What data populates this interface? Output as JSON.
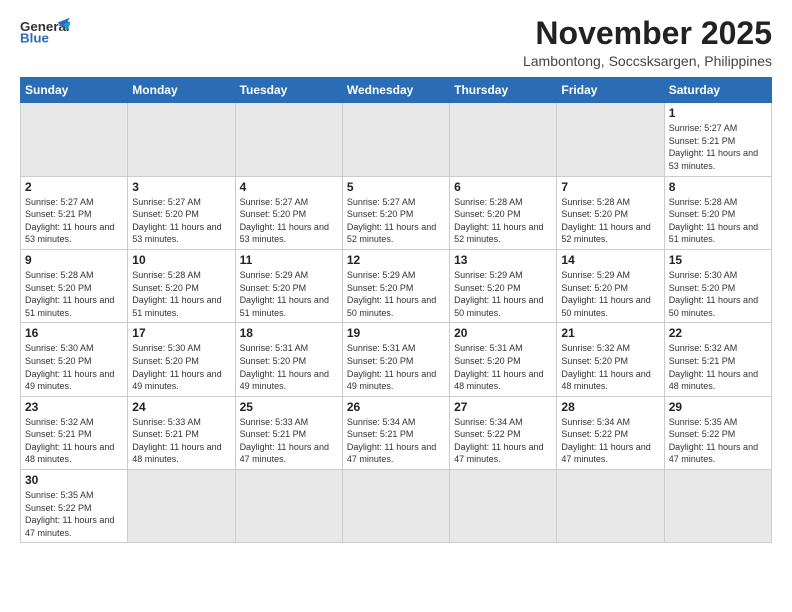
{
  "logo": {
    "text_general": "General",
    "text_blue": "Blue"
  },
  "header": {
    "month": "November 2025",
    "location": "Lambontong, Soccsksargen, Philippines"
  },
  "weekdays": [
    "Sunday",
    "Monday",
    "Tuesday",
    "Wednesday",
    "Thursday",
    "Friday",
    "Saturday"
  ],
  "rows": [
    [
      {
        "day": "",
        "empty": true
      },
      {
        "day": "",
        "empty": true
      },
      {
        "day": "",
        "empty": true
      },
      {
        "day": "",
        "empty": true
      },
      {
        "day": "",
        "empty": true
      },
      {
        "day": "",
        "empty": true
      },
      {
        "day": "1",
        "rise": "Sunrise: 5:27 AM",
        "set": "Sunset: 5:21 PM",
        "daylight": "Daylight: 11 hours and 53 minutes."
      }
    ],
    [
      {
        "day": "2",
        "rise": "Sunrise: 5:27 AM",
        "set": "Sunset: 5:21 PM",
        "daylight": "Daylight: 11 hours and 53 minutes."
      },
      {
        "day": "3",
        "rise": "Sunrise: 5:27 AM",
        "set": "Sunset: 5:20 PM",
        "daylight": "Daylight: 11 hours and 53 minutes."
      },
      {
        "day": "4",
        "rise": "Sunrise: 5:27 AM",
        "set": "Sunset: 5:20 PM",
        "daylight": "Daylight: 11 hours and 53 minutes."
      },
      {
        "day": "5",
        "rise": "Sunrise: 5:27 AM",
        "set": "Sunset: 5:20 PM",
        "daylight": "Daylight: 11 hours and 52 minutes."
      },
      {
        "day": "6",
        "rise": "Sunrise: 5:28 AM",
        "set": "Sunset: 5:20 PM",
        "daylight": "Daylight: 11 hours and 52 minutes."
      },
      {
        "day": "7",
        "rise": "Sunrise: 5:28 AM",
        "set": "Sunset: 5:20 PM",
        "daylight": "Daylight: 11 hours and 52 minutes."
      },
      {
        "day": "8",
        "rise": "Sunrise: 5:28 AM",
        "set": "Sunset: 5:20 PM",
        "daylight": "Daylight: 11 hours and 51 minutes."
      }
    ],
    [
      {
        "day": "9",
        "rise": "Sunrise: 5:28 AM",
        "set": "Sunset: 5:20 PM",
        "daylight": "Daylight: 11 hours and 51 minutes."
      },
      {
        "day": "10",
        "rise": "Sunrise: 5:28 AM",
        "set": "Sunset: 5:20 PM",
        "daylight": "Daylight: 11 hours and 51 minutes."
      },
      {
        "day": "11",
        "rise": "Sunrise: 5:29 AM",
        "set": "Sunset: 5:20 PM",
        "daylight": "Daylight: 11 hours and 51 minutes."
      },
      {
        "day": "12",
        "rise": "Sunrise: 5:29 AM",
        "set": "Sunset: 5:20 PM",
        "daylight": "Daylight: 11 hours and 50 minutes."
      },
      {
        "day": "13",
        "rise": "Sunrise: 5:29 AM",
        "set": "Sunset: 5:20 PM",
        "daylight": "Daylight: 11 hours and 50 minutes."
      },
      {
        "day": "14",
        "rise": "Sunrise: 5:29 AM",
        "set": "Sunset: 5:20 PM",
        "daylight": "Daylight: 11 hours and 50 minutes."
      },
      {
        "day": "15",
        "rise": "Sunrise: 5:30 AM",
        "set": "Sunset: 5:20 PM",
        "daylight": "Daylight: 11 hours and 50 minutes."
      }
    ],
    [
      {
        "day": "16",
        "rise": "Sunrise: 5:30 AM",
        "set": "Sunset: 5:20 PM",
        "daylight": "Daylight: 11 hours and 49 minutes."
      },
      {
        "day": "17",
        "rise": "Sunrise: 5:30 AM",
        "set": "Sunset: 5:20 PM",
        "daylight": "Daylight: 11 hours and 49 minutes."
      },
      {
        "day": "18",
        "rise": "Sunrise: 5:31 AM",
        "set": "Sunset: 5:20 PM",
        "daylight": "Daylight: 11 hours and 49 minutes."
      },
      {
        "day": "19",
        "rise": "Sunrise: 5:31 AM",
        "set": "Sunset: 5:20 PM",
        "daylight": "Daylight: 11 hours and 49 minutes."
      },
      {
        "day": "20",
        "rise": "Sunrise: 5:31 AM",
        "set": "Sunset: 5:20 PM",
        "daylight": "Daylight: 11 hours and 48 minutes."
      },
      {
        "day": "21",
        "rise": "Sunrise: 5:32 AM",
        "set": "Sunset: 5:20 PM",
        "daylight": "Daylight: 11 hours and 48 minutes."
      },
      {
        "day": "22",
        "rise": "Sunrise: 5:32 AM",
        "set": "Sunset: 5:21 PM",
        "daylight": "Daylight: 11 hours and 48 minutes."
      }
    ],
    [
      {
        "day": "23",
        "rise": "Sunrise: 5:32 AM",
        "set": "Sunset: 5:21 PM",
        "daylight": "Daylight: 11 hours and 48 minutes."
      },
      {
        "day": "24",
        "rise": "Sunrise: 5:33 AM",
        "set": "Sunset: 5:21 PM",
        "daylight": "Daylight: 11 hours and 48 minutes."
      },
      {
        "day": "25",
        "rise": "Sunrise: 5:33 AM",
        "set": "Sunset: 5:21 PM",
        "daylight": "Daylight: 11 hours and 47 minutes."
      },
      {
        "day": "26",
        "rise": "Sunrise: 5:34 AM",
        "set": "Sunset: 5:21 PM",
        "daylight": "Daylight: 11 hours and 47 minutes."
      },
      {
        "day": "27",
        "rise": "Sunrise: 5:34 AM",
        "set": "Sunset: 5:22 PM",
        "daylight": "Daylight: 11 hours and 47 minutes."
      },
      {
        "day": "28",
        "rise": "Sunrise: 5:34 AM",
        "set": "Sunset: 5:22 PM",
        "daylight": "Daylight: 11 hours and 47 minutes."
      },
      {
        "day": "29",
        "rise": "Sunrise: 5:35 AM",
        "set": "Sunset: 5:22 PM",
        "daylight": "Daylight: 11 hours and 47 minutes."
      }
    ],
    [
      {
        "day": "30",
        "rise": "Sunrise: 5:35 AM",
        "set": "Sunset: 5:22 PM",
        "daylight": "Daylight: 11 hours and 47 minutes."
      },
      {
        "day": "",
        "empty": true
      },
      {
        "day": "",
        "empty": true
      },
      {
        "day": "",
        "empty": true
      },
      {
        "day": "",
        "empty": true
      },
      {
        "day": "",
        "empty": true
      },
      {
        "day": "",
        "empty": true
      }
    ]
  ]
}
